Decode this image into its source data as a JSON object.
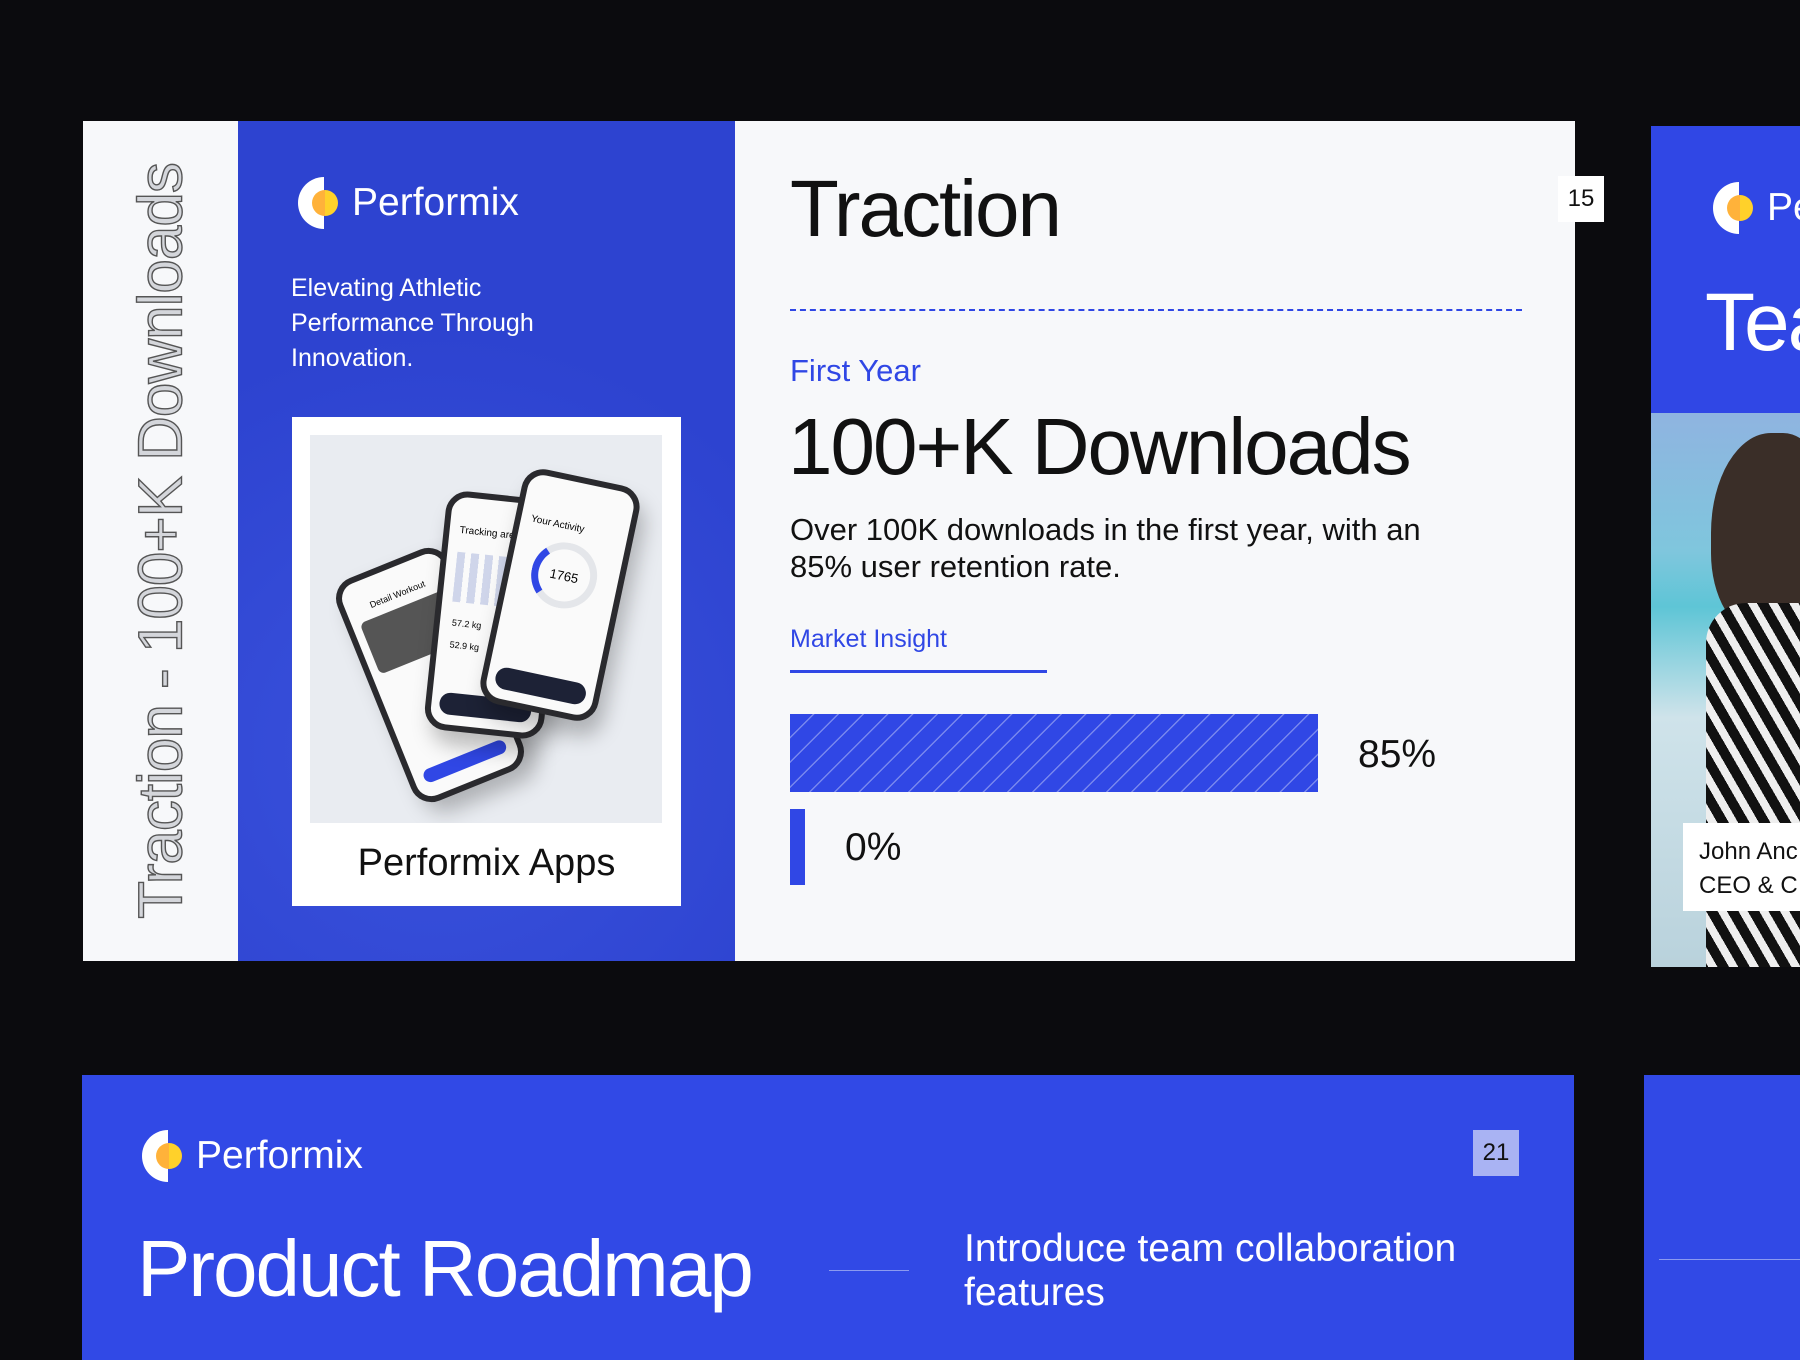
{
  "brand": {
    "name": "Performix",
    "colors": {
      "primary": "#3047e5",
      "accent_yellow": "#ffc22e",
      "background": "#0b0b0e"
    }
  },
  "traction_slide": {
    "vertical_title": "Traction - 100+K Downloads",
    "tagline": [
      "Elevating Athletic",
      "Performance Through",
      "Innovation."
    ],
    "image_caption": "Performix Apps",
    "phone_texts": [
      "Detail Workout",
      "Tracking area",
      "Your Activity",
      "1765",
      "57.2 kg",
      "52.9 kg"
    ],
    "title": "Traction",
    "page_number": "15",
    "subtitle": "First Year",
    "headline": "100+K Downloads",
    "description": [
      "Over 100K downloads in the first year, with an",
      "85% user retention rate."
    ],
    "tab_label": "Market Insight",
    "bars": [
      {
        "label": "85%",
        "value": 85
      },
      {
        "label": "0%",
        "value": 0
      }
    ]
  },
  "team_slide": {
    "brand": "Pe",
    "title": "Tea",
    "person_name": "John Anc",
    "person_role": "CEO & C"
  },
  "roadmap_slide": {
    "title": "Product Roadmap",
    "page_number": "21",
    "item": [
      "Introduce team collaboration",
      "features"
    ]
  }
}
